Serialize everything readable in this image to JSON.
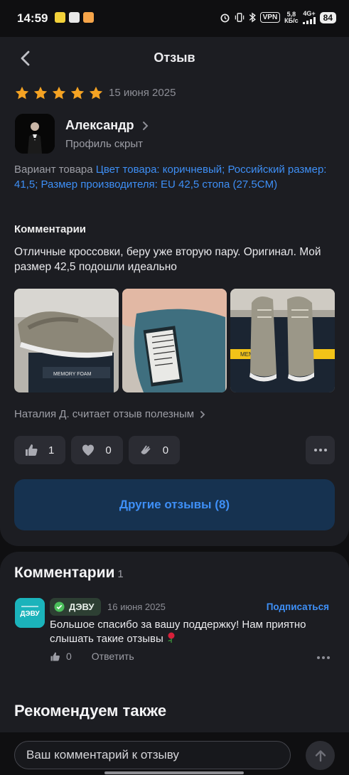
{
  "status_bar": {
    "time": "14:59",
    "vpn": "VPN",
    "speed_value": "5,8",
    "speed_unit": "КБ/с",
    "network": "4G+",
    "battery": "84"
  },
  "header": {
    "title": "Отзыв"
  },
  "review": {
    "rating": 5,
    "date": "15 июня 2025",
    "author": "Александр",
    "profile_status": "Профиль скрыт",
    "variant_label": "Вариант товара",
    "variant_value": "Цвет товара: коричневый; Российский размер: 41,5; Размер производителя: EU 42,5 стопа (27.5CM)",
    "comment_label": "Комментарии",
    "comment_text": "Отличные кроссовки, беру уже вторую пару. Оригинал. Мой размер 42,5 подошли идеально",
    "photo_labels": [
      "MEMORY FOAM",
      "MEMORY FOAM"
    ],
    "helpful_text": "Наталия Д. считает отзыв полезным",
    "reactions": {
      "like": "1",
      "heart": "0",
      "clap": "0"
    },
    "other_reviews_button": "Другие отзывы (8)"
  },
  "comments": {
    "title": "Комментарии",
    "count": "1",
    "items": [
      {
        "brand": "ДЭВУ",
        "date": "16 июня 2025",
        "subscribe": "Подписаться",
        "text": "Большое спасибо за вашу поддержку! Нам приятно слышать такие отзывы",
        "likes": "0",
        "reply": "Ответить"
      }
    ]
  },
  "recommend_title": "Рекомендуем также",
  "comment_input": {
    "placeholder": "Ваш комментарий к отзыву"
  },
  "colors": {
    "background": "#0f0f11",
    "card": "#1c1d22",
    "accent": "#3e8ff6",
    "star": "#f5a323",
    "brand_logo": "#1bb3bb"
  }
}
